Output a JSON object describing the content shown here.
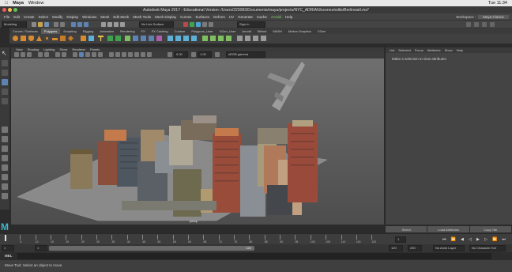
{
  "mac_menubar": {
    "app": "Maya",
    "window": "Window",
    "time": "Tue 11:34"
  },
  "window": {
    "title": "Autodesk Maya 2017 - Educational Version: /Users/223083/Documents/maya/projects/NYC_ADRIAN/scenes/edits/Berlinwall.ma*"
  },
  "main_menu": [
    "File",
    "Edit",
    "Create",
    "Select",
    "Modify",
    "Display",
    "Windows",
    "Mesh",
    "Edit Mesh",
    "Mesh Tools",
    "Mesh Display",
    "Curves",
    "Surfaces",
    "Deform",
    "UV",
    "Generate",
    "Cache",
    "Arnold",
    "Help"
  ],
  "workspace": {
    "label": "Workspace :",
    "value": "Maya Classic"
  },
  "status_line": {
    "mode": "Modeling",
    "live_surface": "No Live Surface",
    "sign_in": "Sign In"
  },
  "shelf_tabs": [
    "Curves / Surfaces",
    "Polygons",
    "Sculpting",
    "Rigging",
    "Animation",
    "Rendering",
    "FX",
    "FX Caching",
    "Custom",
    "Polygons_User",
    "XGen_User",
    "Arnold",
    "Bifrost",
    "MASH",
    "Motion Graphics",
    "XGen"
  ],
  "shelf_active": "Polygons",
  "viewport": {
    "menu": [
      "View",
      "Shading",
      "Lighting",
      "Show",
      "Renderer",
      "Panels"
    ],
    "value_a": "0.00",
    "value_b": "1.00",
    "color_space": "sRGB gamma",
    "camera_label": "persp"
  },
  "attribute_editor": {
    "menu": [
      "List",
      "Selected",
      "Focus",
      "Attributes",
      "Show",
      "Help"
    ],
    "message": "Make a selection to view attributes",
    "buttons": [
      "Select",
      "Load Attributes",
      "Copy Tab"
    ]
  },
  "timeline": {
    "ticks": [
      "5",
      "10",
      "15",
      "20",
      "25",
      "30",
      "35",
      "40",
      "45",
      "50",
      "55",
      "60",
      "65",
      "70",
      "75",
      "80",
      "85",
      "90",
      "95",
      "100",
      "105",
      "110",
      "115",
      "120"
    ],
    "current_frame": "1"
  },
  "range": {
    "start": "1",
    "start_inner": "1",
    "end_inner": "120",
    "end": "120",
    "end_outer": "200",
    "anim_layer": "No Anim Layer",
    "char_set": "No Character Set"
  },
  "command_line": {
    "label": "MEL"
  },
  "help_line": {
    "text": "Move Tool: Select an object to move."
  },
  "colors": {
    "accent_green": "#3fa34d",
    "maya_blue": "#4aa3d6",
    "viewport_bg": "#666666"
  }
}
